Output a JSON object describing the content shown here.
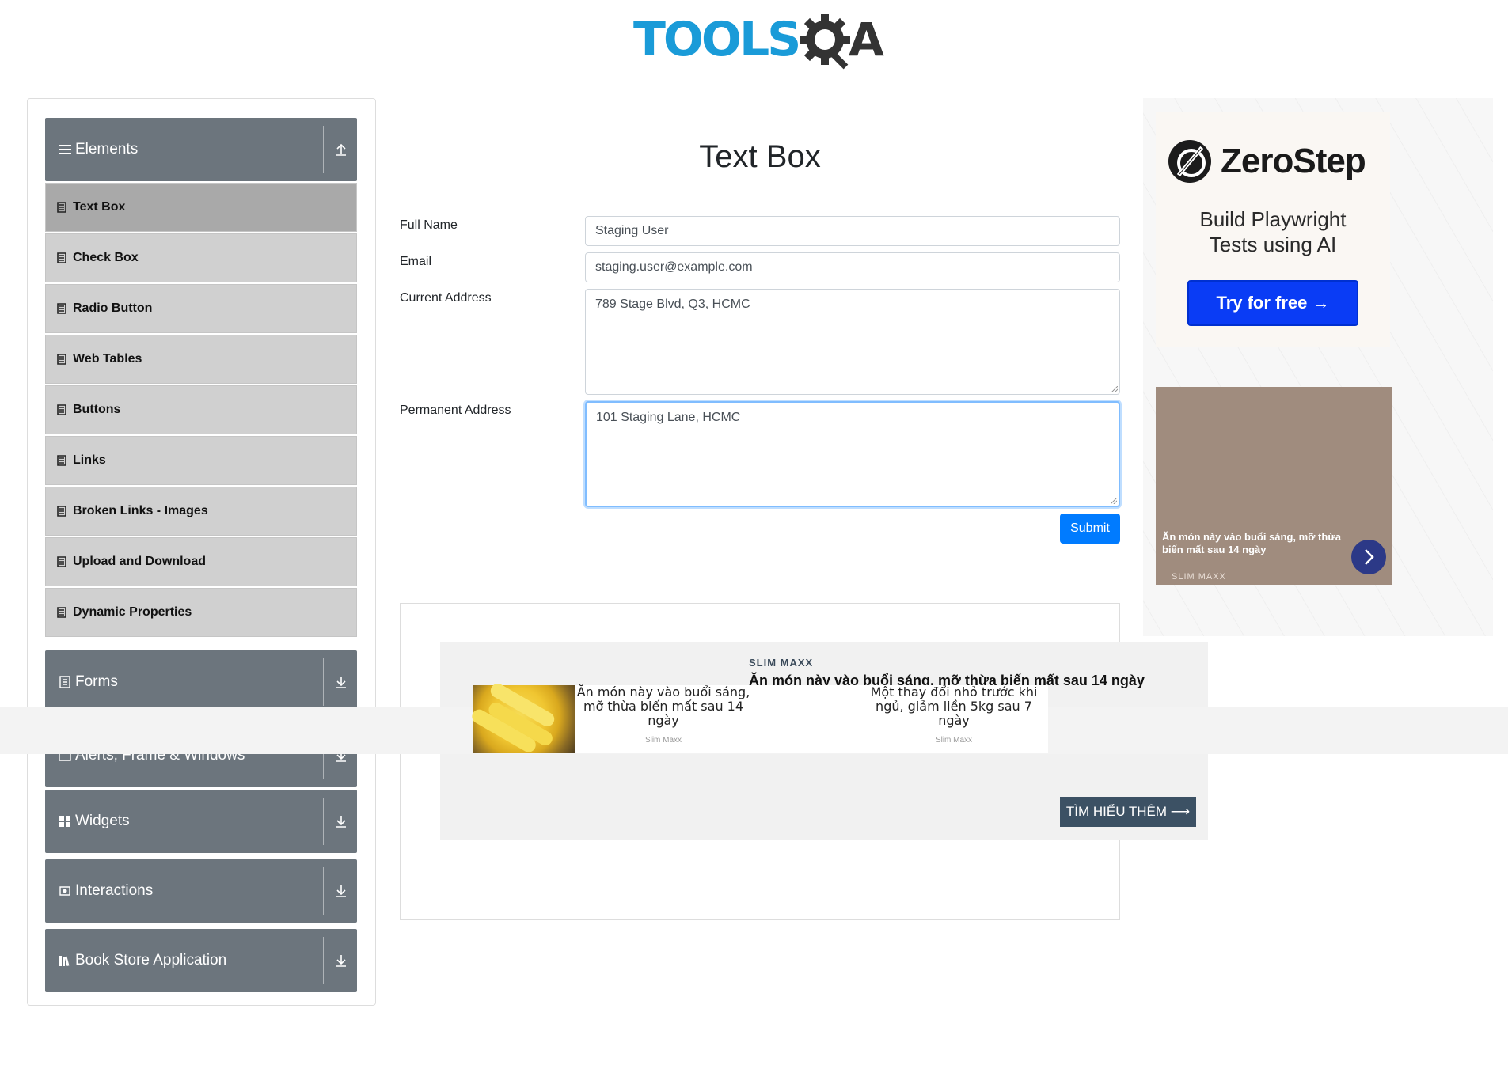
{
  "header": {
    "logo_text": "TOOLS",
    "logo_suffix": "A"
  },
  "sidebar": {
    "groups": [
      {
        "label": "Elements",
        "icon": "hamburger-icon",
        "arrow": "arrow-up-icon"
      },
      {
        "label": "Forms",
        "icon": "document-icon",
        "arrow": "arrow-down-icon"
      },
      {
        "label": "Alerts, Frame & Windows",
        "icon": "window-icon",
        "arrow": "arrow-down-icon"
      },
      {
        "label": "Widgets",
        "icon": "widgets-icon",
        "arrow": "arrow-down-icon"
      },
      {
        "label": "Interactions",
        "icon": "interactions-icon",
        "arrow": "arrow-down-icon"
      },
      {
        "label": "Book Store Application",
        "icon": "books-icon",
        "arrow": "arrow-down-icon"
      }
    ],
    "items": [
      {
        "label": "Text Box",
        "active": true
      },
      {
        "label": "Check Box"
      },
      {
        "label": "Radio Button"
      },
      {
        "label": "Web Tables"
      },
      {
        "label": "Buttons"
      },
      {
        "label": "Links"
      },
      {
        "label": "Broken Links - Images"
      },
      {
        "label": "Upload and Download"
      },
      {
        "label": "Dynamic Properties"
      }
    ]
  },
  "main": {
    "title": "Text Box",
    "fields": {
      "full_name": {
        "label": "Full Name",
        "value": "Staging User"
      },
      "email": {
        "label": "Email",
        "value": "staging.user@example.com"
      },
      "current_address": {
        "label": "Current Address",
        "value": "789 Stage Blvd, Q3, HCMC"
      },
      "permanent_address": {
        "label": "Permanent Address",
        "value": "101 Staging Lane, HCMC"
      }
    },
    "submit_label": "Submit"
  },
  "inline_ad": {
    "brand": "SLIM MAXX",
    "headline": "Ăn món này vào buổi sáng, mỡ thừa biến mất sau 14 ngày",
    "cta": "TÌM HIỂU THÊM ⟶",
    "cards": [
      {
        "text": "Ăn món này vào buổi sáng, mỡ thừa biến mất sau 14 ngày",
        "source": "Slim Maxx"
      },
      {
        "text": "Một thay đổi nhỏ trước khi ngủ, giảm liền 5kg sau 7 ngày",
        "source": "Slim Maxx"
      }
    ]
  },
  "right_ads": {
    "zerostep": {
      "name": "ZeroStep",
      "tagline_line1": "Build Playwright",
      "tagline_line2": "Tests using AI",
      "button": "Try for free →"
    },
    "slimmaxx": {
      "text": "Ăn món này vào buổi sáng, mỡ thừa biến mất sau 14 ngày",
      "source": "SLIM MAXX"
    }
  },
  "colors": {
    "brand_blue": "#1a9bd8",
    "sidebar_header": "#6c757d",
    "menu_item": "#d0d0d0",
    "menu_item_active": "#a9a9a9",
    "submit": "#007bff",
    "zerostep_button": "#0a3cf5"
  }
}
